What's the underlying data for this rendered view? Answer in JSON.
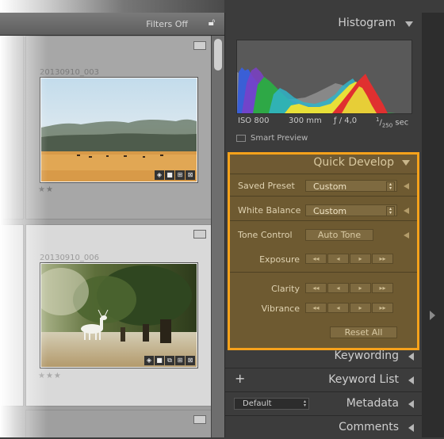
{
  "filterbar": {
    "label": "Filters Off"
  },
  "grid": {
    "cells": [
      {
        "name": "20130910_003",
        "rating": "★★"
      },
      {
        "name": "20130910_006",
        "rating": "★★★"
      }
    ]
  },
  "histogram": {
    "title": "Histogram",
    "iso": "ISO 800",
    "focal": "300 mm",
    "aperture": "ƒ / 4,0",
    "shutter_num": "1",
    "shutter_den": "250",
    "shutter_unit": "sec",
    "smart_preview": "Smart Preview"
  },
  "quick_develop": {
    "title": "Quick Develop",
    "saved_preset_label": "Saved Preset",
    "saved_preset_value": "Custom",
    "white_balance_label": "White Balance",
    "white_balance_value": "Custom",
    "tone_control_label": "Tone Control",
    "auto_tone_label": "Auto Tone",
    "exposure_label": "Exposure",
    "clarity_label": "Clarity",
    "vibrance_label": "Vibrance",
    "reset_all_label": "Reset All"
  },
  "panels": {
    "keywording": "Keywording",
    "keyword_list": "Keyword List",
    "metadata": "Metadata",
    "metadata_preset": "Default",
    "comments": "Comments"
  },
  "colors": {
    "highlight": "#f7a21b",
    "panel_bg": "#3c3c3c",
    "quick_develop_bg": "#6e5a31"
  }
}
